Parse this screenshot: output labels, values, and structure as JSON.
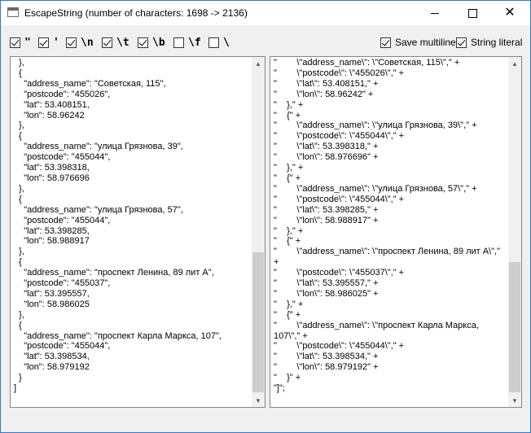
{
  "window": {
    "title": "EscapeString (number of characters: 1698 -> 2136)",
    "min_glyph": "",
    "close_glyph": "✕"
  },
  "options": [
    {
      "label": "\"",
      "checked": true
    },
    {
      "label": "'",
      "checked": true
    },
    {
      "label": "\\n",
      "checked": true
    },
    {
      "label": "\\t",
      "checked": true
    },
    {
      "label": "\\b",
      "checked": true
    },
    {
      "label": "\\f",
      "checked": false
    },
    {
      "label": "\\",
      "checked": false
    }
  ],
  "right_options": [
    {
      "label": "Save multiline",
      "checked": true
    },
    {
      "label": "String literal",
      "checked": true
    }
  ],
  "input_text": "  },\n  {\n    \"address_name\": \"Советская, 115\",\n    \"postcode\": \"455026\",\n    \"lat\": 53.408151,\n    \"lon\": 58.96242\n  },\n  {\n    \"address_name\": \"улица Грязнова, 39\",\n    \"postcode\": \"455044\",\n    \"lat\": 53.398318,\n    \"lon\": 58.976696\n  },\n  {\n    \"address_name\": \"улица Грязнова, 57\",\n    \"postcode\": \"455044\",\n    \"lat\": 53.398285,\n    \"lon\": 58.988917\n  },\n  {\n    \"address_name\": \"проспект Ленина, 89 лит А\",\n    \"postcode\": \"455037\",\n    \"lat\": 53.395557,\n    \"lon\": 58.986025\n  },\n  {\n    \"address_name\": \"проспект Карла Маркса, 107\",\n    \"postcode\": \"455044\",\n    \"lat\": 53.398534,\n    \"lon\": 58.979192\n  }\n]",
  "output_text": "\"        \\\"address_name\\\": \\\"Советская, 115\\\",\" +\n\"        \\\"postcode\\\": \\\"455026\\\",\" +\n\"        \\\"lat\\\": 53.408151,\" +\n\"        \\\"lon\\\": 58.96242\" +\n\"    },\" +\n\"    {\" +\n\"        \\\"address_name\\\": \\\"улица Грязнова, 39\\\",\" +\n\"        \\\"postcode\\\": \\\"455044\\\",\" +\n\"        \\\"lat\\\": 53.398318,\" +\n\"        \\\"lon\\\": 58.976696\" +\n\"    },\" +\n\"    {\" +\n\"        \\\"address_name\\\": \\\"улица Грязнова, 57\\\",\" +\n\"        \\\"postcode\\\": \\\"455044\\\",\" +\n\"        \\\"lat\\\": 53.398285,\" +\n\"        \\\"lon\\\": 58.988917\" +\n\"    },\" +\n\"    {\" +\n\"        \\\"address_name\\\": \\\"проспект Ленина, 89 лит А\\\",\"\n+\n\"        \\\"postcode\\\": \\\"455037\\\",\" +\n\"        \\\"lat\\\": 53.395557,\" +\n\"        \\\"lon\\\": 58.986025\" +\n\"    },\" +\n\"    {\" +\n\"        \\\"address_name\\\": \\\"проспект Карла Маркса,\n107\\\",\" +\n\"        \\\"postcode\\\": \\\"455044\\\",\" +\n\"        \\\"lat\\\": 53.398534,\" +\n\"        \\\"lon\\\": 58.979192\" +\n\"    }\" +\n\"]\";",
  "scroll_arrows": {
    "up": "▲",
    "down": "▼"
  },
  "colors": {
    "accent_border": "#2b79d6",
    "scroll_thumb": "#cdcdcd"
  }
}
